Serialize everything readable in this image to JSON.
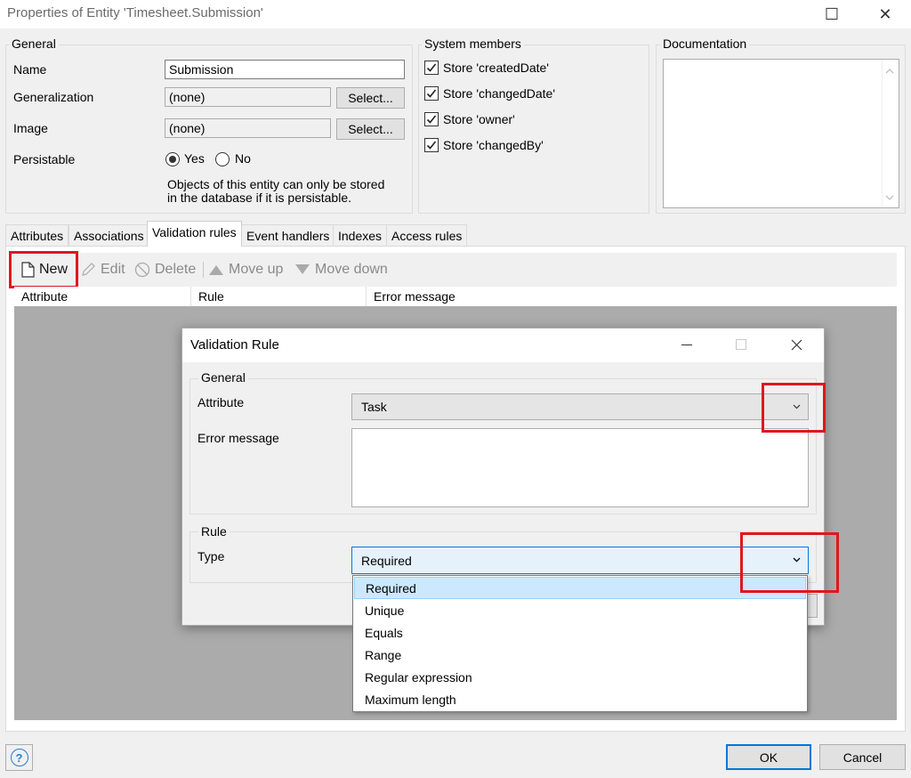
{
  "window": {
    "title": "Properties of Entity 'Timesheet.Submission'",
    "maximize_icon": "☐",
    "close_icon": "✕"
  },
  "general": {
    "group_label": "General",
    "name_label": "Name",
    "name_value": "Submission",
    "generalization_label": "Generalization",
    "generalization_value": "(none)",
    "image_label": "Image",
    "image_value": "(none)",
    "select_label": "Select...",
    "persistable_label": "Persistable",
    "yes_label": "Yes",
    "no_label": "No",
    "note_line1": "Objects of this entity can only be stored",
    "note_line2": "in the database if it is persistable."
  },
  "system_members": {
    "group_label": "System members",
    "items": [
      "Store 'createdDate'",
      "Store 'changedDate'",
      "Store 'owner'",
      "Store 'changedBy'"
    ]
  },
  "documentation": {
    "group_label": "Documentation"
  },
  "tabs": [
    "Attributes",
    "Associations",
    "Validation rules",
    "Event handlers",
    "Indexes",
    "Access rules"
  ],
  "toolbar": {
    "new_label": "New",
    "edit_label": "Edit",
    "delete_label": "Delete",
    "move_up_label": "Move up",
    "move_down_label": "Move down"
  },
  "table": {
    "columns": [
      "Attribute",
      "Rule",
      "Error message"
    ]
  },
  "dialog": {
    "title": "Validation Rule",
    "general_label": "General",
    "attribute_label": "Attribute",
    "attribute_value": "Task",
    "error_message_label": "Error message",
    "rule_label": "Rule",
    "type_label": "Type",
    "type_value": "Required",
    "type_options": [
      "Required",
      "Unique",
      "Equals",
      "Range",
      "Regular expression",
      "Maximum length"
    ]
  },
  "footer": {
    "ok_label": "OK",
    "cancel_label": "Cancel",
    "help_icon": "?"
  },
  "colors": {
    "highlight_red": "#e0161f",
    "selection_blue": "#cce8ff",
    "disabled_area": "#ababab"
  }
}
